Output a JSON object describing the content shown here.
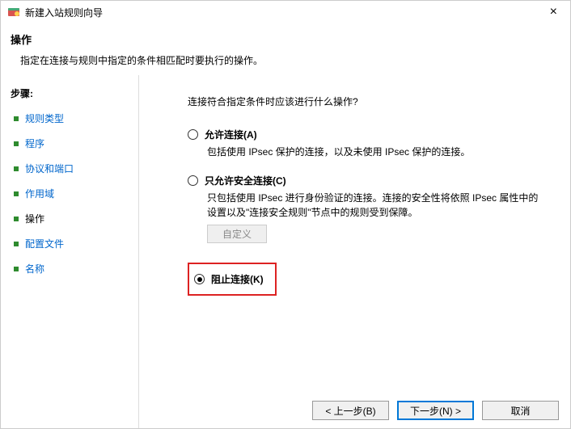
{
  "titlebar": {
    "title": "新建入站规则向导",
    "close": "×"
  },
  "header": {
    "title": "操作",
    "desc": "指定在连接与规则中指定的条件相匹配时要执行的操作。"
  },
  "sidebar": {
    "title": "步骤:",
    "steps": [
      {
        "label": "规则类型",
        "current": false
      },
      {
        "label": "程序",
        "current": false
      },
      {
        "label": "协议和端口",
        "current": false
      },
      {
        "label": "作用域",
        "current": false
      },
      {
        "label": "操作",
        "current": true
      },
      {
        "label": "配置文件",
        "current": false
      },
      {
        "label": "名称",
        "current": false
      }
    ]
  },
  "content": {
    "question": "连接符合指定条件时应该进行什么操作?",
    "options": [
      {
        "label": "允许连接(A)",
        "desc": "包括使用 IPsec 保护的连接，以及未使用 IPsec 保护的连接。",
        "checked": false
      },
      {
        "label": "只允许安全连接(C)",
        "desc": "只包括使用 IPsec 进行身份验证的连接。连接的安全性将依照 IPsec 属性中的设置以及\"连接安全规则\"节点中的规则受到保障。",
        "checked": false
      },
      {
        "label": "阻止连接(K)",
        "desc": "",
        "checked": true
      }
    ],
    "customize": "自定义"
  },
  "footer": {
    "back": "< 上一步(B)",
    "next": "下一步(N) >",
    "cancel": "取消"
  }
}
